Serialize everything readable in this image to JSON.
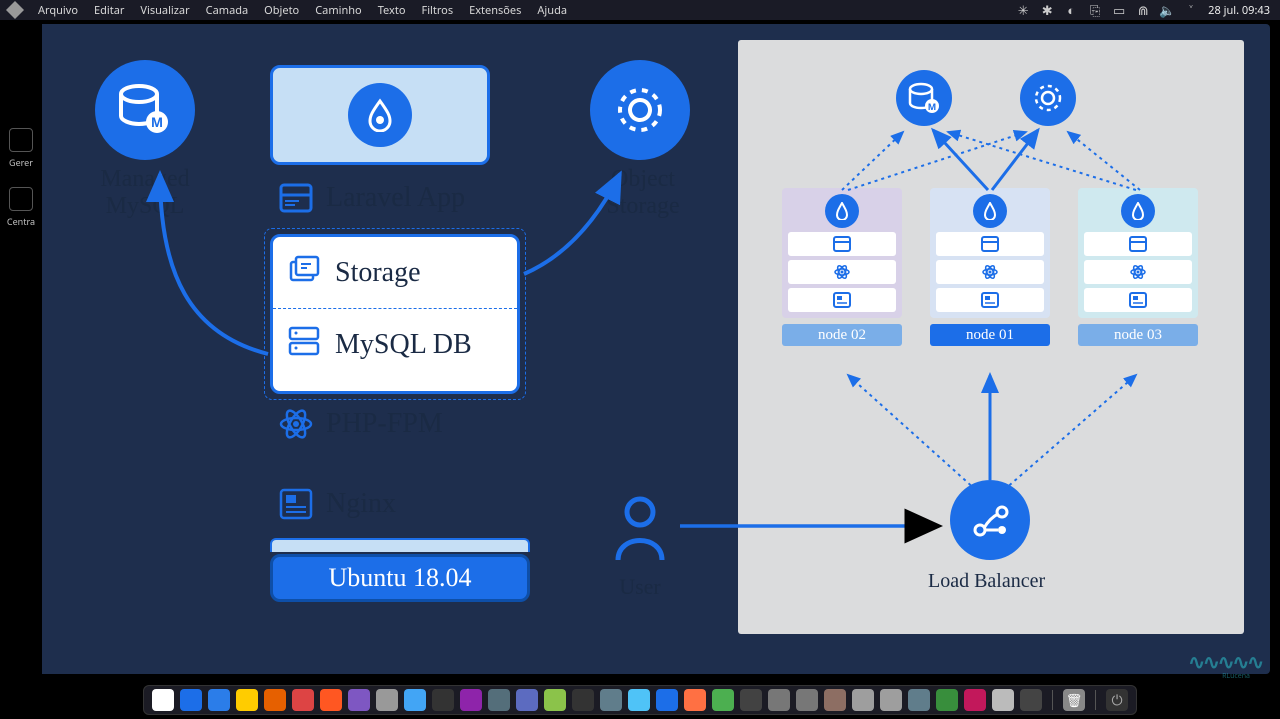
{
  "menubar": {
    "items": [
      "Arquivo",
      "Editar",
      "Visualizar",
      "Camada",
      "Objeto",
      "Caminho",
      "Texto",
      "Filtros",
      "Extensões",
      "Ajuda"
    ],
    "clock": "28 jul. 09:43"
  },
  "leftbar": {
    "items": [
      "Gerer",
      "Centra"
    ]
  },
  "diagram_left": {
    "managed_mysql_l1": "Managed",
    "managed_mysql_l2": "MySQL",
    "laravel_app": "Laravel App",
    "storage": "Storage",
    "mysql_db": "MySQL DB",
    "php_fpm": "PHP-FPM",
    "nginx": "Nginx",
    "ubuntu": "Ubuntu 18.04",
    "object_storage_l1": "Object",
    "object_storage_l2": "Storage",
    "user": "User"
  },
  "diagram_right": {
    "node01": "node 01",
    "node02": "node 02",
    "node03": "node 03",
    "load_balancer": "Load Balancer"
  },
  "watermark": "RLucena",
  "dock_colors": [
    "#ffffff",
    "#1c6ee8",
    "#2b7de9",
    "#ffcc00",
    "#e66000",
    "#d44",
    "#ff5722",
    "#7e57c2",
    "#999",
    "#42a5f5",
    "#333",
    "#8e24aa",
    "#546e7a",
    "#5c6bc0",
    "#8bc34a",
    "#333",
    "#607d8b",
    "#4fc3f7",
    "#1c6ee8",
    "#ff7043",
    "#4caf50",
    "#424242",
    "#777",
    "#777",
    "#8d6e63",
    "#9e9e9e",
    "#9e9e9e",
    "#607d8b",
    "#388e3c",
    "#c2185b",
    "#bbb",
    "#444"
  ]
}
